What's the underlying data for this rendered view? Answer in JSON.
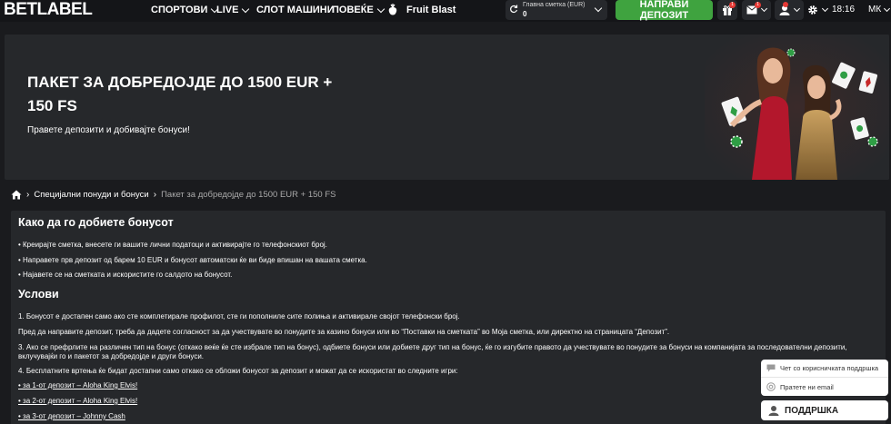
{
  "header": {
    "logo": "BETLABEL",
    "nav": [
      {
        "label": "СПОРТОВИ",
        "dropdown": true
      },
      {
        "label": "LIVE",
        "dropdown": true
      },
      {
        "label": "СЛОТ МАШИНИ",
        "dropdown": false
      },
      {
        "label": "ПОВЕЌЕ",
        "dropdown": true
      }
    ],
    "promo_game": "Fruit Blast",
    "balance_label": "Главна сметка  (EUR)",
    "balance_value": "0",
    "deposit_button": "НАПРАВИ ДЕПОЗИТ",
    "notifications_count": "1",
    "messages_count": "1",
    "time": "18:16",
    "language": "МК"
  },
  "hero": {
    "title": "ПАКЕТ ЗА ДОБРЕДОЈДЕ ДО 1500 EUR + 150 FS",
    "subtitle": "Правете депозити и добивајте бонуси!"
  },
  "breadcrumb": {
    "parent": "Специјални понуди и бонуси",
    "current": "Пакет за добредојде до 1500 EUR + 150 FS"
  },
  "content": {
    "how_title": "Како да го добиете бонусот",
    "how_items": [
      "• Креирајте сметка, внесете ги вашите лични податоци и активирајте го телефонскиот број.",
      "• Направете прв депозит од барем 10 EUR и бонусот автоматски ќе ви биде впишан на вашата сметка.",
      "• Најавете се на сметката и искористите го салдото на бонусот."
    ],
    "terms_title": "Услови",
    "terms": [
      "1. Бонусот е достапен само ако сте комплетирале профилот, сте ги пополниле сите полиња и активирале својот телефонски број.",
      "Пред да направите депозит, треба да дадете согласност за да учествувате во понудите за казино бонуси или во “Поставки на сметката” во Моја сметка, или директно на страницата “Депозит”.",
      "3. Ако се префрлите на различен тип на бонус (откако веќе ќе сте избрале тип на бонус), одбиете бонуси или добиете друг тип на бонус, ќе го изгубите правото да учествувате во понудите за бонуси на компанијата за последователни депозити, вклучувајќи го и пакетот за добредојде и други бонуси.",
      "4. Бесплатните вртења ќе бидат достапни само откако се обложи бонусот за депозит и можат да се искористат во следните игри:"
    ],
    "game_links": [
      "• за 1-от депозит – Aloha King Elvis!",
      "• за 2-от депозит – Aloha King Elvis!",
      "• за 3-от депозит – Johnny Cash"
    ]
  },
  "support": {
    "chat_label": "Чет со корисничката поддршка",
    "email_label": "Пратете ни email",
    "button_label": "ПОДДРШКА"
  }
}
